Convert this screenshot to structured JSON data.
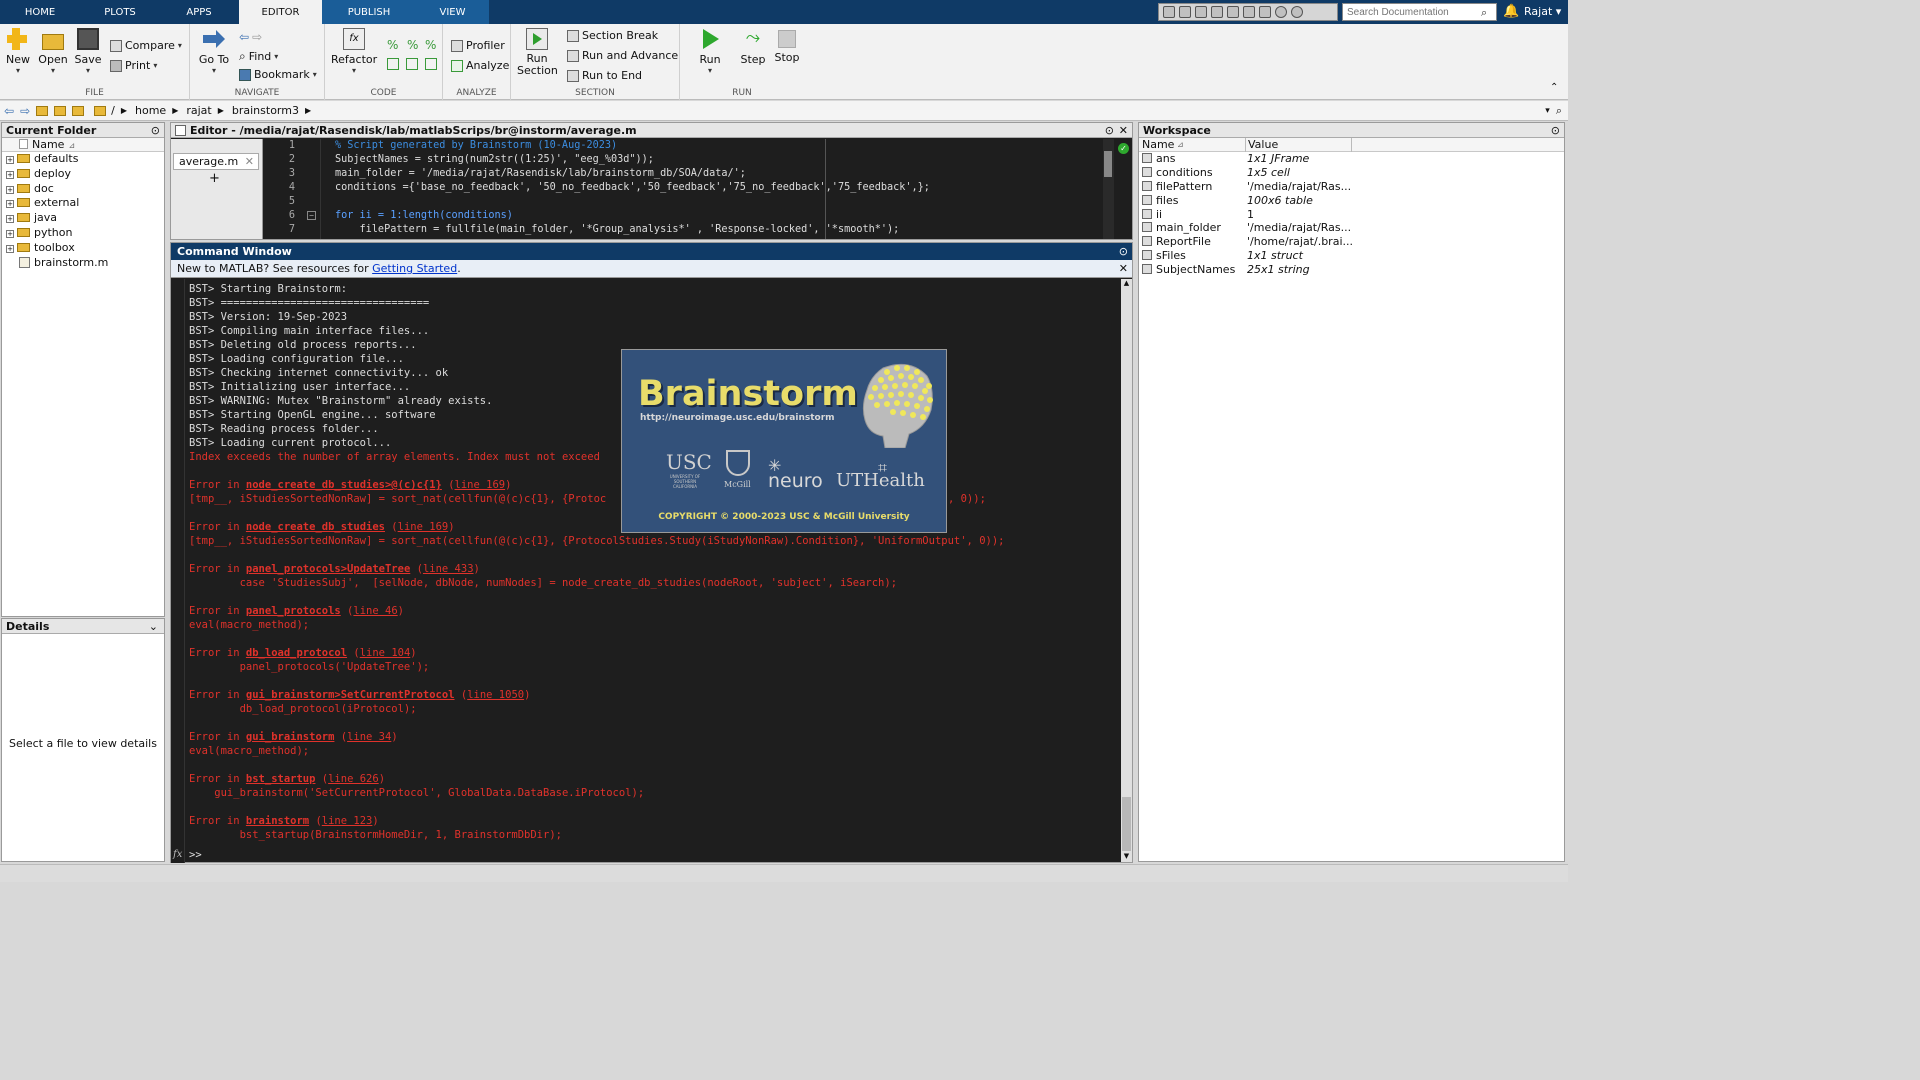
{
  "tabs": [
    {
      "label": "HOME"
    },
    {
      "label": "PLOTS"
    },
    {
      "label": "APPS"
    },
    {
      "label": "EDITOR"
    },
    {
      "label": "PUBLISH"
    },
    {
      "label": "VIEW"
    }
  ],
  "search_placeholder": "Search Documentation",
  "user": "Rajat",
  "ribbon": {
    "file": {
      "label": "FILE",
      "new": "New",
      "open": "Open",
      "save": "Save",
      "compare": "Compare",
      "print": "Print"
    },
    "navigate": {
      "label": "NAVIGATE",
      "goto": "Go To",
      "find": "Find",
      "bookmark": "Bookmark"
    },
    "code": {
      "label": "CODE",
      "refactor": "Refactor"
    },
    "analyze": {
      "label": "ANALYZE",
      "profiler": "Profiler",
      "analyze": "Analyze"
    },
    "section": {
      "label": "SECTION",
      "run_section": "Run\nSection",
      "section_break": "Section Break",
      "run_advance": "Run and Advance",
      "run_end": "Run to End"
    },
    "run": {
      "label": "RUN",
      "run": "Run",
      "step": "Step",
      "stop": "Stop"
    }
  },
  "address": {
    "sep": "/",
    "parts": [
      "home",
      "rajat",
      "brainstorm3"
    ]
  },
  "current_folder": {
    "title": "Current Folder",
    "col_name": "Name",
    "items": [
      {
        "name": "defaults",
        "type": "folder"
      },
      {
        "name": "deploy",
        "type": "folder"
      },
      {
        "name": "doc",
        "type": "folder"
      },
      {
        "name": "external",
        "type": "folder"
      },
      {
        "name": "java",
        "type": "folder"
      },
      {
        "name": "python",
        "type": "folder"
      },
      {
        "name": "toolbox",
        "type": "folder"
      },
      {
        "name": "brainstorm.m",
        "type": "file"
      }
    ]
  },
  "details": {
    "title": "Details",
    "empty_text": "Select a file to view details"
  },
  "editor": {
    "title": "Editor - /media/rajat/Rasendisk/lab/matlabScrips/br@instorm/average.m",
    "file_tab": "average.m",
    "lines": [
      {
        "n": "1",
        "text": "% Script generated by Brainstorm (10-Aug-2023)"
      },
      {
        "n": "2",
        "text": "SubjectNames = string(num2str((1:25)', \"eeg_%03d\"));"
      },
      {
        "n": "3",
        "text": "main_folder = '/media/rajat/Rasendisk/lab/brainstorm_db/SOA/data/';"
      },
      {
        "n": "4",
        "text": "conditions ={'base_no_feedback', '50_no_feedback','50_feedback','75_no_feedback','75_feedback',};"
      },
      {
        "n": "5",
        "text": ""
      },
      {
        "n": "6",
        "text": "for ii = 1:length(conditions)"
      },
      {
        "n": "7",
        "text": "    filePattern = fullfile(main_folder, '*Group_analysis*' , 'Response-locked', '*smooth*');"
      }
    ]
  },
  "command_window": {
    "title": "Command Window",
    "banner_prefix": "New to MATLAB? See resources for ",
    "banner_link": "Getting Started",
    "banner_suffix": ".",
    "prompt": ">>",
    "lines": [
      "BST> Starting Brainstorm:",
      "BST> =================================",
      "BST> Version: 19-Sep-2023",
      "BST> Compiling main interface files...",
      "BST> Deleting old process reports...",
      "BST> Loading configuration file...",
      "BST> Checking internet connectivity... ok",
      "BST> Initializing user interface...",
      "BST> WARNING: Mutex \"Brainstorm\" already exists.",
      "BST> Starting OpenGL engine... software",
      "BST> Reading process folder...",
      "BST> Loading current protocol..."
    ],
    "errors": {
      "index": "Index exceeds the number of array elements. Index must not exceed",
      "e1_fn": "node_create_db_studies>@(c)c{1}",
      "e1_ln": "line 169",
      "e1_code": "[tmp__, iStudiesSortedNonRaw] = sort_nat(cellfun(@(c)c{1}, {Protoc",
      "e1_tail": "ut', 0));",
      "e2_fn": "node_create_db_studies",
      "e2_ln": "line 169",
      "e2_code": "[tmp__, iStudiesSortedNonRaw] = sort_nat(cellfun(@(c)c{1}, {ProtocolStudies.Study(iStudyNonRaw).Condition}, 'UniformOutput', 0));",
      "e3_fn": "panel_protocols>UpdateTree",
      "e3_ln": "line 433",
      "e3_code": "        case 'StudiesSubj',  [selNode, dbNode, numNodes] = node_create_db_studies(nodeRoot, 'subject', iSearch);",
      "e4_fn": "panel_protocols",
      "e4_ln": "line 46",
      "e4_code": "eval(macro_method);",
      "e5_fn": "db_load_protocol",
      "e5_ln": "line 104",
      "e5_code": "        panel_protocols('UpdateTree');",
      "e6_fn": "gui_brainstorm>SetCurrentProtocol",
      "e6_ln": "line 1050",
      "e6_code": "        db_load_protocol(iProtocol);",
      "e7_fn": "gui_brainstorm",
      "e7_ln": "line 34",
      "e7_code": "eval(macro_method);",
      "e8_fn": "bst_startup",
      "e8_ln": "line 626",
      "e8_code": "    gui_brainstorm('SetCurrentProtocol', GlobalData.DataBase.iProtocol);",
      "e9_fn": "brainstorm",
      "e9_ln": "line 123",
      "e9_code": "        bst_startup(BrainstormHomeDir, 1, BrainstormDbDir);",
      "err_prefix": "Error in "
    }
  },
  "splash": {
    "title": "Brainstorm",
    "url": "http://neuroimage.usc.edu/brainstorm",
    "usc": "USC",
    "usc_sub": "UNIVERSITY OF SOUTHERN CALIFORNIA",
    "mcgill": "McGill",
    "neuro": "neuro",
    "uthealth": "UTHealth",
    "copyright": "COPYRIGHT © 2000-2023  USC & McGill University"
  },
  "workspace": {
    "title": "Workspace",
    "col_name": "Name",
    "col_value": "Value",
    "vars": [
      {
        "name": "ans",
        "value": "1x1 JFrame"
      },
      {
        "name": "conditions",
        "value": "1x5 cell"
      },
      {
        "name": "filePattern",
        "value": "'/media/rajat/Ras..."
      },
      {
        "name": "files",
        "value": "100x6 table"
      },
      {
        "name": "ii",
        "value": "1"
      },
      {
        "name": "main_folder",
        "value": "'/media/rajat/Ras..."
      },
      {
        "name": "ReportFile",
        "value": "'/home/rajat/.brai..."
      },
      {
        "name": "sFiles",
        "value": "1x1 struct"
      },
      {
        "name": "SubjectNames",
        "value": "25x1 string"
      }
    ]
  },
  "colors": {
    "titlebar": "#0f3a66",
    "error": "#e0322b",
    "splash_bg": "#33517a",
    "brand_yellow": "#f0e060"
  }
}
